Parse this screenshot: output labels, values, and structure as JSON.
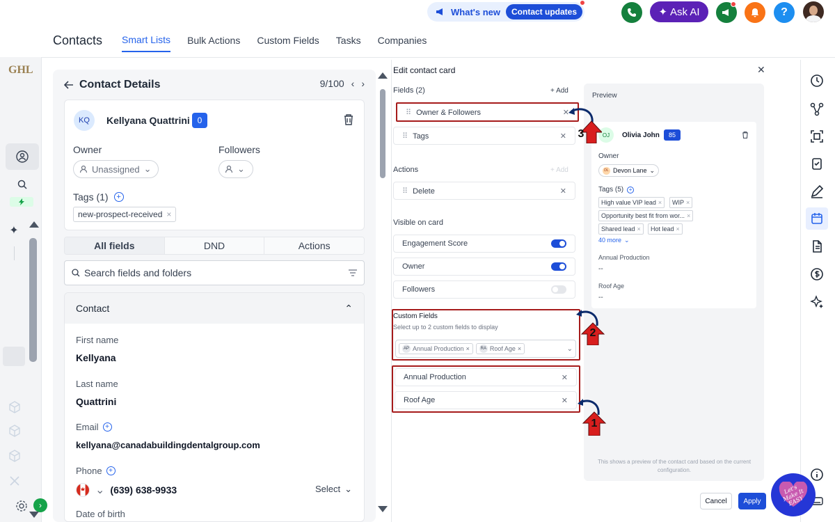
{
  "topbar": {
    "whats_new": "What's new",
    "contact_updates": "Contact updates",
    "ask_ai": "Ask AI",
    "help": "?"
  },
  "nav": {
    "title": "Contacts",
    "tabs": [
      "Smart Lists",
      "Bulk Actions",
      "Custom Fields",
      "Tasks",
      "Companies"
    ]
  },
  "brand": "GHL",
  "contact_details": {
    "title": "Contact Details",
    "pager": "9/100",
    "avatar_initials": "KQ",
    "name": "Kellyana Quattrini",
    "badge": "0",
    "owner_label": "Owner",
    "owner_value": "Unassigned",
    "followers_label": "Followers",
    "tags_label": "Tags (1)",
    "tag": "new-prospect-received",
    "tabs": [
      "All fields",
      "DND",
      "Actions"
    ],
    "search_placeholder": "Search fields and folders",
    "section_title": "Contact",
    "fields": {
      "first_name_label": "First name",
      "first_name": "Kellyana",
      "last_name_label": "Last name",
      "last_name": "Quattrini",
      "email_label": "Email",
      "email": "kellyana@canadabuildingdentalgroup.com",
      "phone_label": "Phone",
      "phone": "(639) 638-9933",
      "phone_select": "Select",
      "dob_label": "Date of birth"
    }
  },
  "edit_card": {
    "title": "Edit contact card",
    "fields_label": "Fields (2)",
    "add": "+ Add",
    "fields": [
      "Owner & Followers",
      "Tags"
    ],
    "actions_label": "Actions",
    "actions": [
      "Delete"
    ],
    "visible_label": "Visible on card",
    "visible": [
      {
        "label": "Engagement Score",
        "on": true
      },
      {
        "label": "Owner",
        "on": true
      },
      {
        "label": "Followers",
        "on": false
      }
    ],
    "custom_label": "Custom Fields",
    "custom_hint": "Select up to 2 custom fields to display",
    "selected_chips": [
      {
        "abbr": "AP",
        "label": "Annual Production"
      },
      {
        "abbr": "RA",
        "label": "Roof Age"
      }
    ],
    "custom_rows": [
      "Annual Production",
      "Roof Age"
    ],
    "cancel": "Cancel",
    "apply": "Apply"
  },
  "preview": {
    "label": "Preview",
    "avatar_initials": "OJ",
    "name": "Olivia John",
    "badge": "85",
    "owner_label": "Owner",
    "owner_initials": "DL",
    "owner_value": "Devon Lane",
    "tags_label": "Tags (5)",
    "tags": [
      "High value VIP lead",
      "WIP",
      "Opportunity best fit from wor...",
      "Shared lead",
      "Hot lead"
    ],
    "more": "40 more",
    "annual_label": "Annual Production",
    "annual_value": "--",
    "roof_label": "Roof Age",
    "roof_value": "--",
    "footer": "This shows a preview of the contact card based on the current configuration."
  },
  "markers": [
    "3",
    "2",
    "1"
  ],
  "stamp_text": "Let's Make It EASY",
  "colors": {
    "accent": "#2563eb",
    "marker_red": "#a61b1b",
    "arrow": "#0b2a6b"
  }
}
